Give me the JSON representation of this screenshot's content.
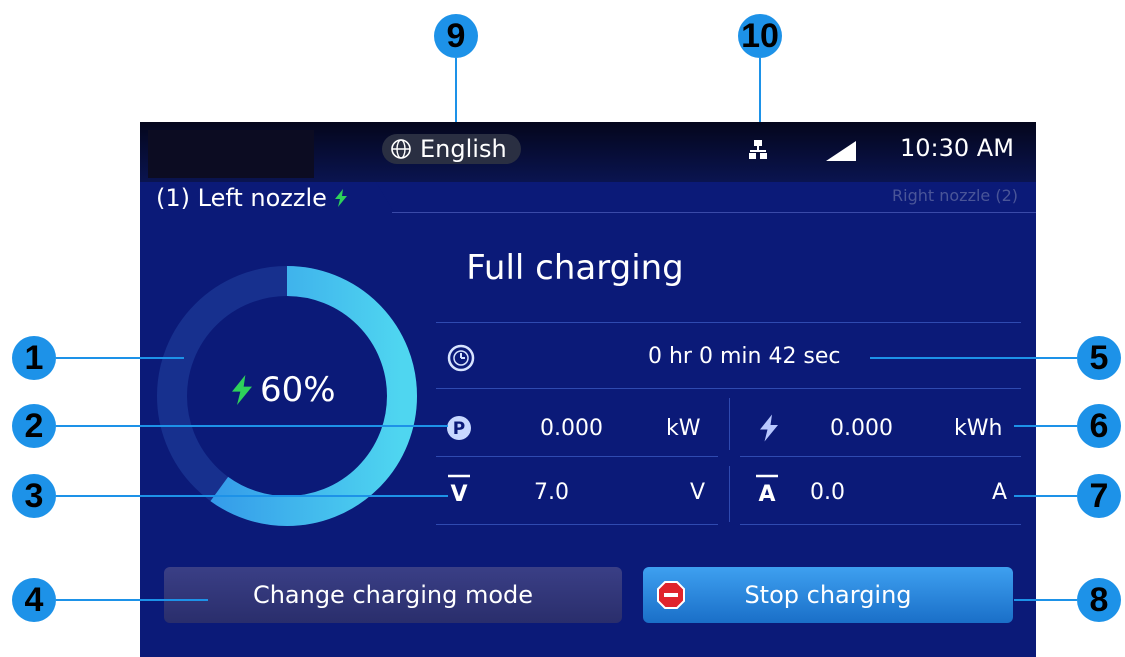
{
  "header": {
    "language": "English",
    "time": "10:30 AM",
    "icons": [
      "globe-icon",
      "network-icon",
      "signal-icon"
    ]
  },
  "tabs": {
    "left": "(1) Left nozzle",
    "right": "Right nozzle (2)"
  },
  "charge": {
    "percent_label": "60%",
    "percent_value": 60,
    "status": "Full charging",
    "elapsed": "0 hr 0 min 42 sec"
  },
  "metrics": {
    "power": {
      "value": "0.000",
      "unit": "kW"
    },
    "energy": {
      "value": "0.000",
      "unit": "kWh"
    },
    "voltage": {
      "value": "7.0",
      "unit": "V"
    },
    "current": {
      "value": "0.0",
      "unit": "A"
    }
  },
  "buttons": {
    "change_mode": "Change charging mode",
    "stop": "Stop charging"
  },
  "callouts": [
    "1",
    "2",
    "3",
    "4",
    "5",
    "6",
    "7",
    "8",
    "9",
    "10"
  ],
  "colors": {
    "screen_bg": "#0b1a78",
    "ring_track": "#17308e",
    "ring_fill_start": "#2f8fe8",
    "ring_fill_end": "#4fd6f0",
    "bolt_green": "#2ed15a",
    "callout_blue": "#1d92e8",
    "stop_red": "#e0242c"
  }
}
